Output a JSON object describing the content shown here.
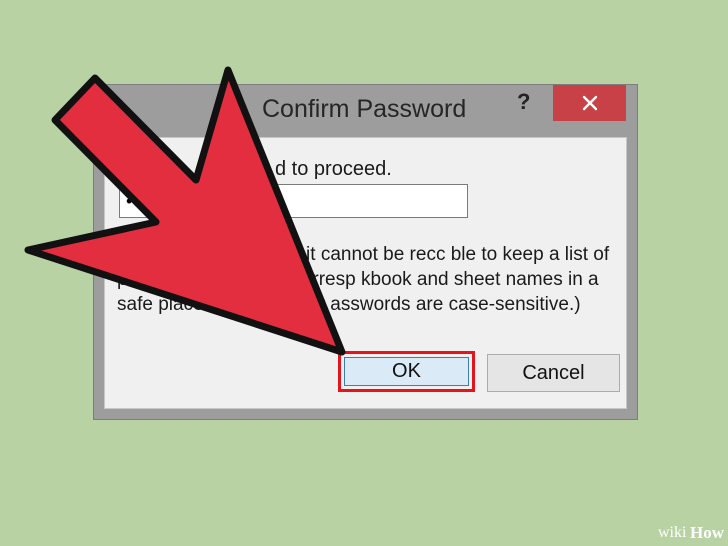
{
  "dialog": {
    "title": "Confirm Password",
    "help_label": "?",
    "close_icon": "close-icon",
    "prompt_visible": "d to proceed.",
    "password_value": "•",
    "caution_text": "r forget the password, it cannot be recc                    ble to keep a list of passwords and their corresp                kbook and sheet names in a safe place.  (Remember t        asswords are case-sensitive.)",
    "ok_label": "OK",
    "cancel_label": "Cancel"
  },
  "colors": {
    "background": "#b9d2a4",
    "arrow_fill": "#e22e3e",
    "close_button": "#c74146",
    "ok_highlight": "#e3141c"
  },
  "watermark": {
    "wiki": "wiki",
    "how": "How"
  }
}
